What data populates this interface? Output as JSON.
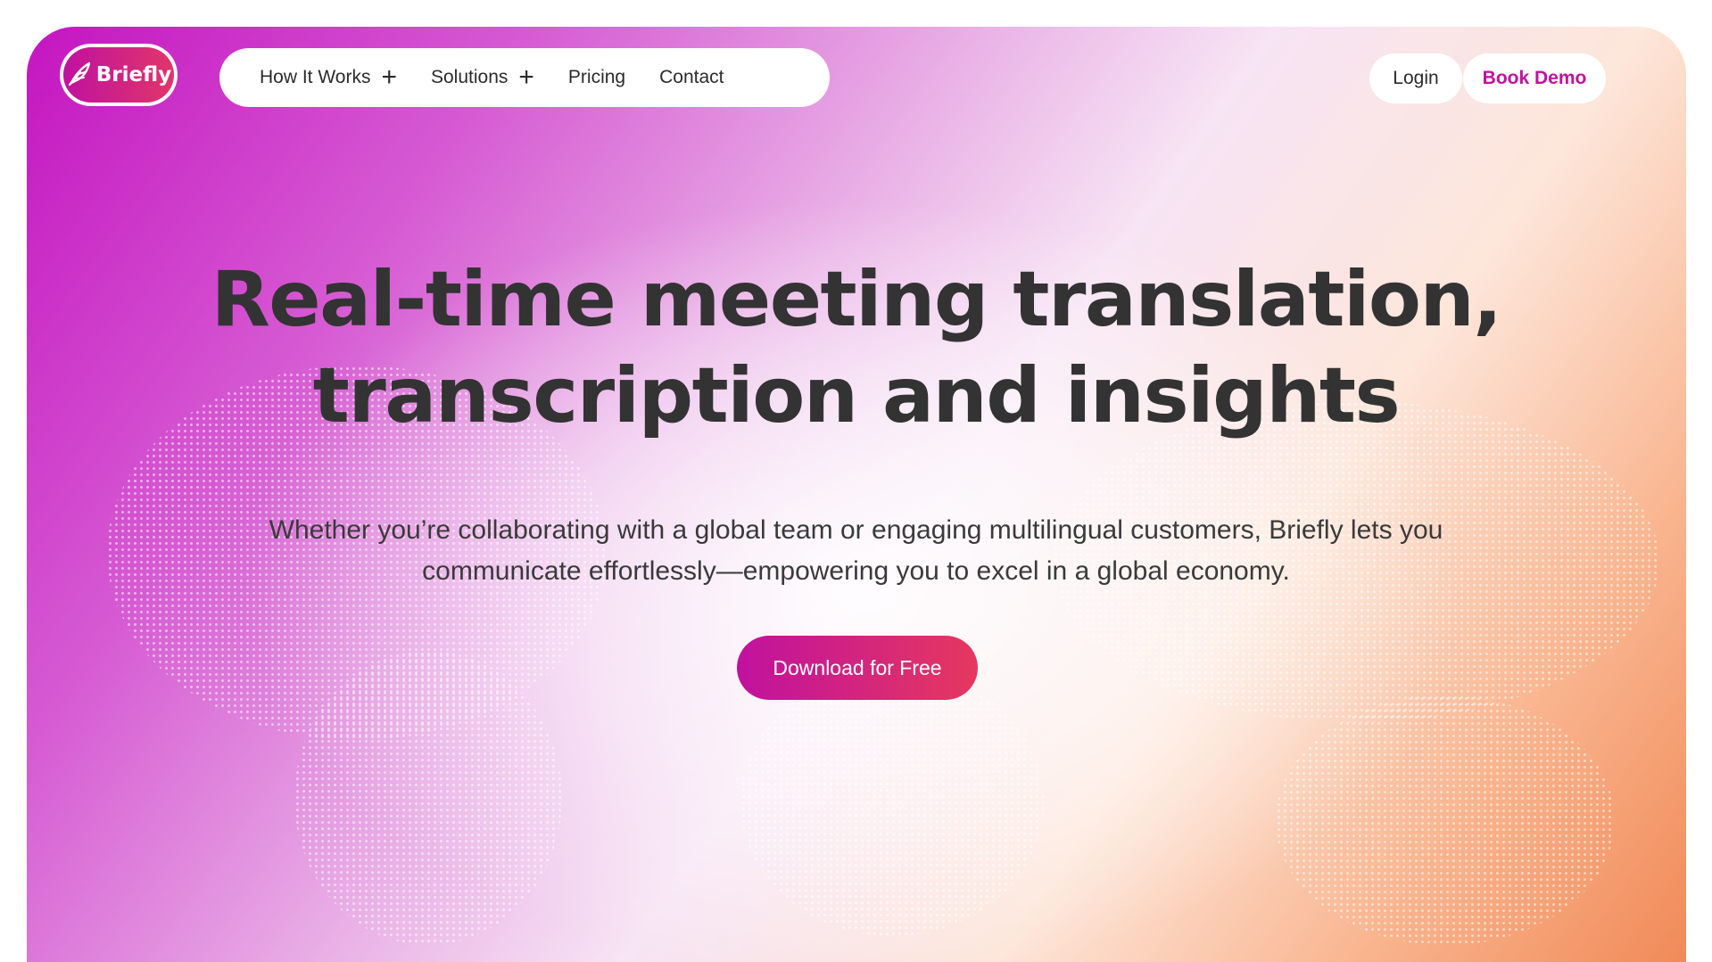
{
  "brand": {
    "name": "Briefly",
    "logo_icon": "feather-icon"
  },
  "nav": {
    "items": [
      {
        "label": "How It Works",
        "has_submenu": true
      },
      {
        "label": "Solutions",
        "has_submenu": true
      },
      {
        "label": "Pricing",
        "has_submenu": false
      },
      {
        "label": "Contact",
        "has_submenu": false
      }
    ],
    "login_label": "Login",
    "demo_label": "Book Demo"
  },
  "hero": {
    "headline_line1": "Real-time meeting translation,",
    "headline_line2": "transcription and insights",
    "subtext": "Whether you’re collaborating with a global team or engaging multilingual customers, Briefly lets you communicate effortlessly—empowering you to excel in a global economy.",
    "cta_label": "Download for Free",
    "background_graphic": "dotted-world-map"
  },
  "colors": {
    "brand_magenta": "#c0119f",
    "brand_coral": "#e6385e",
    "text_dark": "#333333",
    "gradient_orange": "#f18a58"
  }
}
